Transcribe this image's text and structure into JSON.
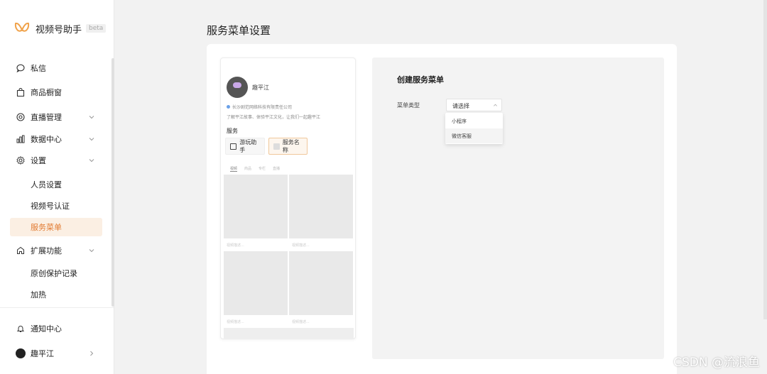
{
  "brand": {
    "title": "视频号助手",
    "badge": "beta"
  },
  "sidebar": {
    "items": [
      {
        "label": "私信",
        "icon": "chat-bubble-icon"
      },
      {
        "label": "商品橱窗",
        "icon": "shopping-bag-icon"
      },
      {
        "label": "直播管理",
        "icon": "live-icon",
        "expandable": true
      },
      {
        "label": "数据中心",
        "icon": "bar-chart-icon",
        "expandable": true
      },
      {
        "label": "设置",
        "icon": "gear-icon",
        "expandable": true
      }
    ],
    "settings_sub": [
      "人员设置",
      "视频号认证",
      "服务菜单"
    ],
    "active_sub": "服务菜单",
    "extend": {
      "label": "扩展功能",
      "icon": "puzzle-icon",
      "expandable": true
    },
    "extend_sub": [
      "原创保护记录",
      "加热"
    ],
    "notifications": {
      "label": "通知中心",
      "icon": "bell-icon"
    },
    "account": {
      "label": "趣平江"
    }
  },
  "page": {
    "title": "服务菜单设置"
  },
  "preview": {
    "name": "趣平江",
    "company": "长沙剧范网络科技有限责任公司",
    "bio": "了解平江故事、体验平江文化，让我们一起趣平江",
    "services_heading": "服务",
    "buttons": [
      "游玩助手",
      "服务名称"
    ],
    "tabs": [
      "视频",
      "商品",
      "专栏",
      "直播"
    ],
    "captions": [
      "视频描述...",
      "视频描述...",
      "视频描述...",
      "视频描述..."
    ]
  },
  "config": {
    "title": "创建服务菜单",
    "menu_type_label": "菜单类型",
    "select_placeholder": "请选择",
    "options": [
      "小程序",
      "微信客服"
    ],
    "hovered_option": "微信客服"
  },
  "watermark": "CSDN @流浪鱼",
  "colors": {
    "accent": "#e27b32",
    "active_bg": "#fbefe3"
  }
}
